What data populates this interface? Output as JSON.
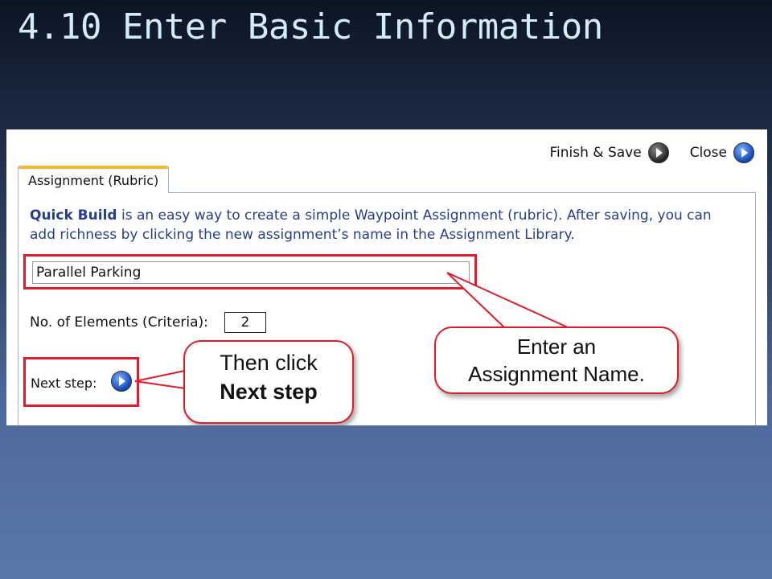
{
  "slide": {
    "title": "4.10 Enter Basic Information"
  },
  "toolbar": {
    "finish_save_label": "Finish & Save",
    "close_label": "Close"
  },
  "tab": {
    "label": "Assignment (Rubric)"
  },
  "intro": {
    "bold_text": "Quick Build",
    "rest_text": " is an easy way to create a simple Waypoint Assignment (rubric). After saving, you can add richness by clicking the new assignment’s name in the Assignment Library."
  },
  "form": {
    "assignment_name_value": "Parallel Parking",
    "elements_label": "No. of Elements (Criteria):",
    "elements_value": "2",
    "next_step_label": "Next step:"
  },
  "callouts": {
    "name_line1": "Enter an",
    "name_line2": "Assignment Name.",
    "next_line1": "Then click",
    "next_line2": "Next step"
  },
  "colors": {
    "highlight_red": "#e21b2a",
    "tab_accent": "#f0b93c",
    "intro_text": "#243e8c",
    "title_text": "#d4ecf7"
  }
}
